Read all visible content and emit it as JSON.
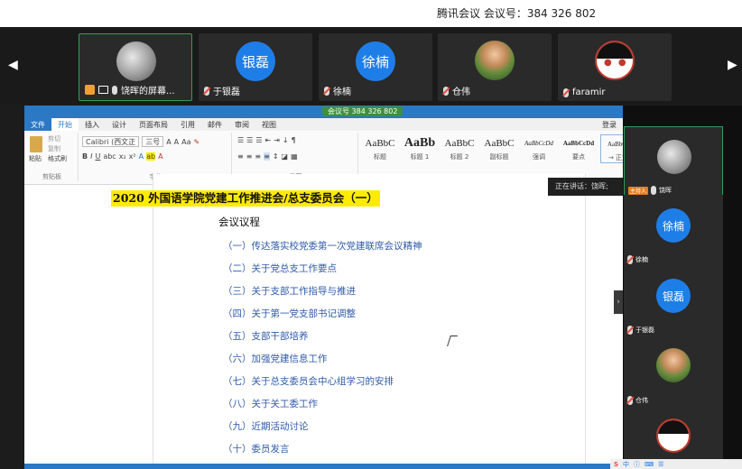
{
  "meeting": {
    "title": "腾讯会议 会议号：384 326 802",
    "meeting_tag": "会议号 384 326 802"
  },
  "strip": {
    "left_arrow": "◀",
    "right_arrow": "▶",
    "tiles": [
      {
        "name": "饶晖的屏幕...",
        "avatar": "photo",
        "initials": ""
      },
      {
        "name": "于银磊",
        "avatar": "initials",
        "initials": "银磊"
      },
      {
        "name": "徐楠",
        "avatar": "initials",
        "initials": "徐楠"
      },
      {
        "name": "仓伟",
        "avatar": "kid-photo",
        "initials": ""
      },
      {
        "name": "faramir",
        "avatar": "mask-photo",
        "initials": ""
      }
    ]
  },
  "word": {
    "tabs": [
      "文件",
      "开始",
      "插入",
      "设计",
      "页面布局",
      "引用",
      "邮件",
      "审阅",
      "视图"
    ],
    "login": "登录",
    "font_name": "Calibri (西文正",
    "font_size": "三号",
    "group_labels": {
      "clipboard": "剪贴板",
      "font": "字体",
      "paragraph": "段落",
      "styles": "样式"
    },
    "clipboard": {
      "paste": "粘贴",
      "cut": "剪切",
      "copy": "复制",
      "format": "格式刷"
    },
    "styles": [
      {
        "sample": "AaBbC",
        "name": "标题"
      },
      {
        "sample": "AaBb",
        "name": "标题 1"
      },
      {
        "sample": "AaBbC",
        "name": "标题 2"
      },
      {
        "sample": "AaBbC",
        "name": "副标题"
      },
      {
        "sample": "AaBbCcDd",
        "name": "强调"
      },
      {
        "sample": "AaBbCcDd",
        "name": "要点"
      },
      {
        "sample": "AaBbCc",
        "name": "→ 正文"
      }
    ]
  },
  "document": {
    "title": "2020 外国语学院党建工作推进会/总支委员会（一）",
    "agenda_heading": "会议议程",
    "items": [
      "（一）传达落实校党委第一次党建联席会议精神",
      "（二）关于党总支工作要点",
      "（三）关于支部工作指导与推进",
      "（四）关于第一党支部书记调整",
      "（五）支部干部培养",
      "（六）加强党建信息工作",
      "（七）关于总支委员会中心组学习的安排",
      "（八）关于关工委工作",
      "（九）近期活动讨论",
      "（十）委员发言"
    ]
  },
  "speaking": "正在讲话：饶晖;",
  "right_panel": {
    "host_badge": "主持人",
    "tiles": [
      {
        "name": "饶晖",
        "avatar": "photo",
        "initials": "",
        "host": true
      },
      {
        "name": "徐楠",
        "avatar": "initials",
        "initials": "徐楠",
        "host": false
      },
      {
        "name": "于银磊",
        "avatar": "initials",
        "initials": "银磊",
        "host": false
      },
      {
        "name": "仓伟",
        "avatar": "kid-photo",
        "initials": "",
        "host": false
      },
      {
        "name": "",
        "avatar": "mask-photo",
        "initials": "",
        "host": false
      }
    ]
  },
  "colors": {
    "accent": "#1e7ee8",
    "word_blue": "#2b78c4",
    "highlight": "#ffeb00",
    "active_border": "#2f9e58"
  }
}
